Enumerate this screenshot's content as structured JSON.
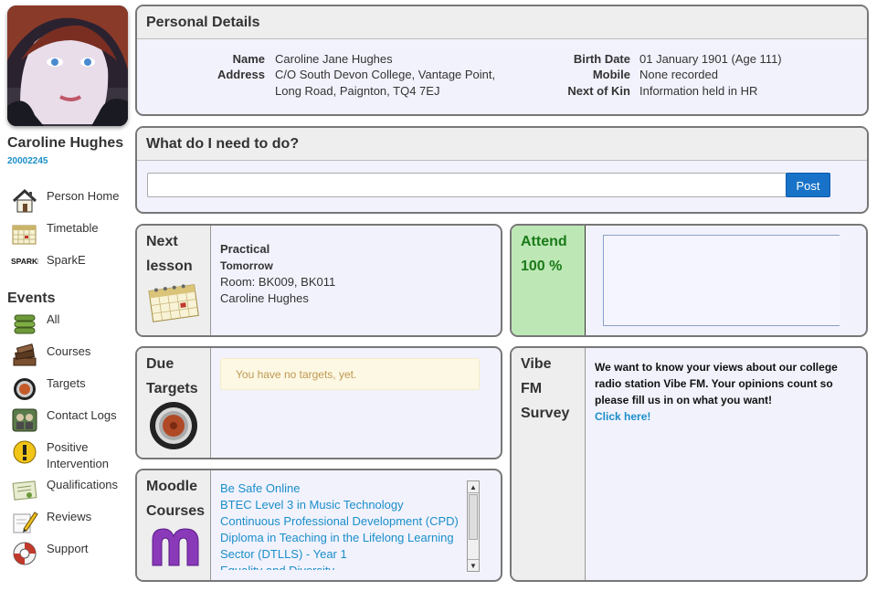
{
  "profile": {
    "name": "Caroline Hughes",
    "id": "20002245"
  },
  "nav": [
    {
      "label": "Person Home",
      "icon": "house-icon"
    },
    {
      "label": "Timetable",
      "icon": "calendar-icon"
    },
    {
      "label": "SparkE",
      "icon": "sparke-logo-icon"
    }
  ],
  "events": {
    "heading": "Events",
    "items": [
      {
        "label": "All",
        "icon": "stack-icon"
      },
      {
        "label": "Courses",
        "icon": "books-icon"
      },
      {
        "label": "Targets",
        "icon": "target-icon"
      },
      {
        "label": "Contact Logs",
        "icon": "contact-logs-icon"
      },
      {
        "label": "Positive",
        "label2": "Intervention",
        "icon": "exclamation-icon"
      },
      {
        "label": "Qualifications",
        "icon": "certificate-icon"
      },
      {
        "label": "Reviews",
        "icon": "pencil-icon"
      },
      {
        "label": "Support",
        "icon": "lifebuoy-icon"
      }
    ]
  },
  "personal_details": {
    "title": "Personal Details",
    "name_label": "Name",
    "name_value": "Caroline Jane Hughes",
    "address_label": "Address",
    "address_line1": "C/O South Devon College, Vantage Point,",
    "address_line2": "Long Road, Paignton, TQ4 7EJ",
    "birth_label": "Birth Date",
    "birth_value": "01 January 1901 (Age 111)",
    "mobile_label": "Mobile",
    "mobile_value": "None recorded",
    "kin_label": "Next of Kin",
    "kin_value": "Information held in HR"
  },
  "todo": {
    "title": "What do I need to do?",
    "input_value": "",
    "post_label": "Post"
  },
  "next_lesson": {
    "label1": "Next",
    "label2": "lesson",
    "type": "Practical",
    "when": "Tomorrow",
    "room": "Room: BK009, BK011",
    "teacher": "Caroline Hughes"
  },
  "attend": {
    "label": "Attend",
    "percent": "100 %",
    "label_color": "#1a7a1a",
    "bg_color": "#bde8b5"
  },
  "due_targets": {
    "label1": "Due",
    "label2": "Targets",
    "message": "You have no targets, yet."
  },
  "moodle": {
    "label1": "Moodle",
    "label2": "Courses",
    "courses": [
      "Be Safe Online",
      "BTEC Level 3 in Music Technology",
      "Continuous Professional Development (CPD)",
      "Diploma in Teaching in the Lifelong Learning",
      "Sector (DTLLS) - Year 1",
      "Equality and Diversity"
    ]
  },
  "survey": {
    "label1": "Vibe",
    "label2": "FM",
    "label3": "Survey",
    "text": "We want to know your views about our college radio station Vibe FM. Your opinions count so please fill us in on what you want!",
    "link": "Click here!"
  },
  "colors": {
    "accent": "#1a8fc9",
    "button": "#1873c8",
    "panel_bg": "#f2f2fd",
    "header_bg": "#eeeeee"
  }
}
